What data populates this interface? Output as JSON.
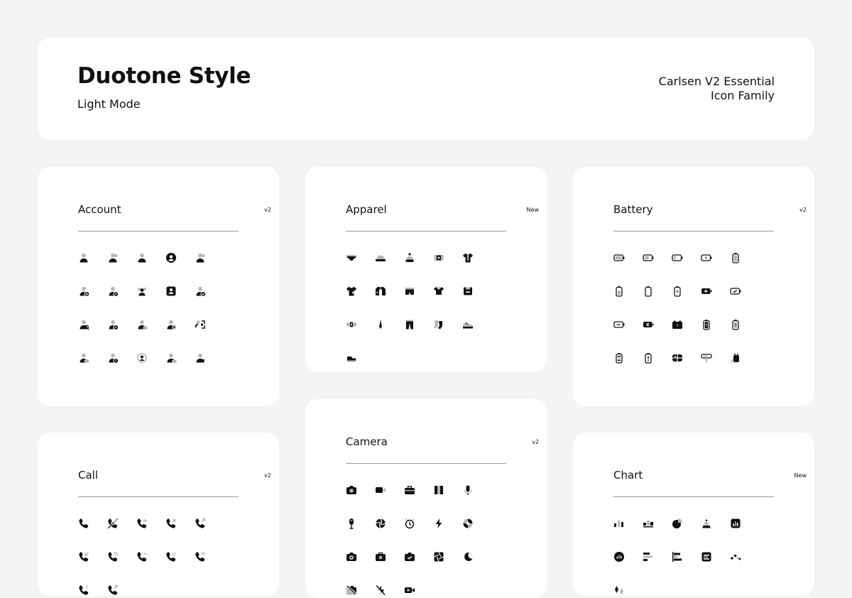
{
  "header": {
    "title": "Duotone Style",
    "subtitle": "Light Mode",
    "family_line1": "Carlsen V2 Essential",
    "family_line2": "Icon Family"
  },
  "colors": {
    "background": "#f4f4f4",
    "card": "#ffffff",
    "ink": "#111111",
    "tone": "#b5b5b5",
    "divider": "#9a9a9a"
  },
  "cards": [
    {
      "title": "Account",
      "badge": "v2",
      "icons": [
        "user",
        "user-group",
        "user-alt",
        "user-circle",
        "user-pair",
        "user-add",
        "user-edit",
        "user-team",
        "user-card",
        "user-check",
        "user-search",
        "user-remove",
        "user-lock",
        "user-settings",
        "user-swap",
        "user-cloud",
        "user-info",
        "user-sync",
        "user-laptop",
        "user-link"
      ]
    },
    {
      "title": "Apparel",
      "badge": "New",
      "icons": [
        "underwear",
        "cap",
        "beanie",
        "wallet",
        "shirt",
        "tshirt",
        "jacket",
        "shorts",
        "polo",
        "sweater",
        "belt",
        "tie",
        "pants",
        "socks",
        "sneaker",
        "shoe"
      ]
    },
    {
      "title": "Battery",
      "badge": "v2",
      "icons": [
        "battery-full-h",
        "battery-half-h",
        "battery-low-h",
        "battery-charge-h",
        "battery-full-v",
        "battery-half-v",
        "battery-empty-v",
        "battery-charge-v",
        "battery-plus-h",
        "battery-check-h",
        "battery-minus-h",
        "battery-x-h",
        "car-battery",
        "battery-bolt-v",
        "battery-level-v",
        "battery-levels-v",
        "battery-warning-v",
        "battery-grid",
        "battery-cable",
        "battery-plug"
      ]
    },
    {
      "title": "Call",
      "badge": "v2",
      "icons": [
        "phone",
        "phone-slash",
        "phone-add",
        "phone-remove",
        "phone-outgoing",
        "phone-incoming",
        "phone-signal",
        "phone-minus",
        "phone-check",
        "phone-pause",
        "phone-info",
        "phone-forward"
      ]
    },
    {
      "title": "Camera",
      "badge": "v2",
      "icons": [
        "camera",
        "video-camera",
        "camera-bag",
        "film",
        "microphone",
        "mic-stand",
        "aperture",
        "timer",
        "flash",
        "shutter",
        "camera-alt",
        "camera-case",
        "camera-check",
        "image-aperture",
        "night-mode",
        "camera-off",
        "no-flash",
        "video-record"
      ]
    },
    {
      "title": "Chart",
      "badge": "New",
      "icons": [
        "bar-chart",
        "column-chart",
        "pie-chart",
        "pyramid-chart",
        "chart-square",
        "chart-circle",
        "bar-horizontal",
        "bar-align",
        "chart-list",
        "scatter-chart",
        "diamond-chart"
      ]
    }
  ]
}
